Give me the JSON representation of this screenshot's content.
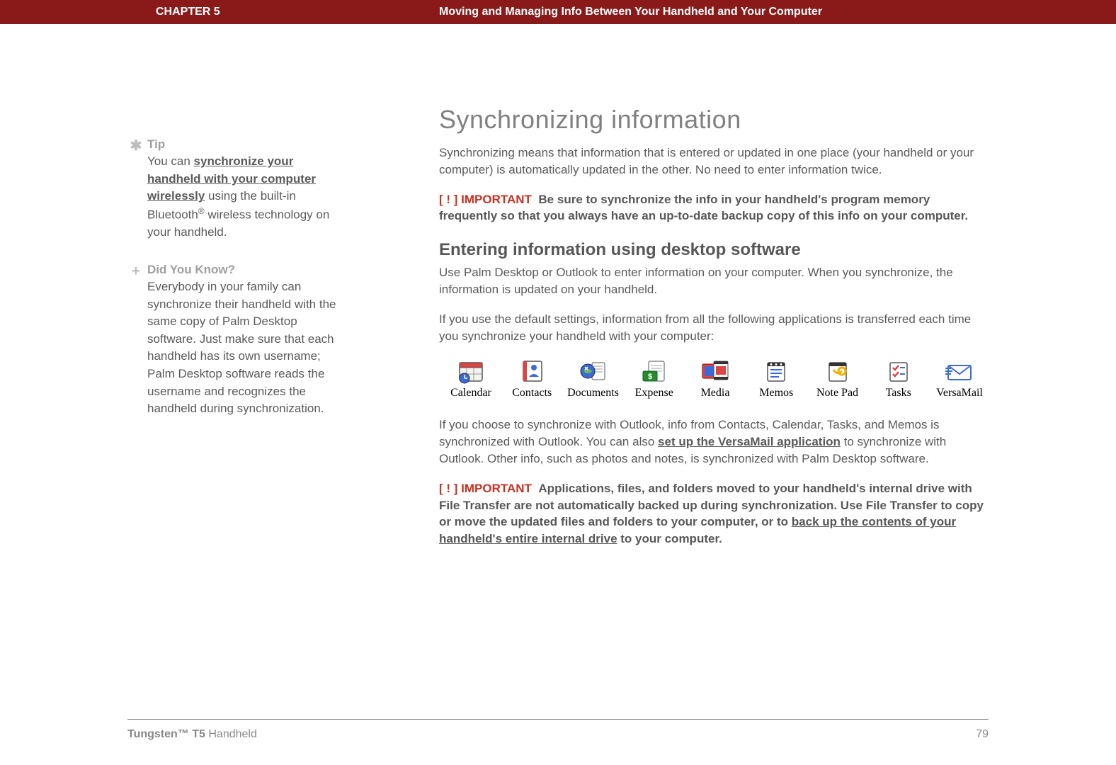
{
  "header": {
    "chapter": "CHAPTER 5",
    "title": "Moving and Managing Info Between Your Handheld and Your Computer"
  },
  "sidebar": {
    "tip": {
      "heading": "Tip",
      "linkText": "synchronize your handheld with your computer wirelessly",
      "afterText": " using the built-in Bluetooth",
      "reg": "®",
      "afterReg": " wireless technology on your handheld."
    },
    "dyk": {
      "heading": "Did You Know?",
      "text": "Everybody in your family can synchronize their handheld with the same copy of Palm Desktop software. Just make sure that each handheld has its own username; Palm Desktop software reads the username and recognizes the handheld during synchronization."
    }
  },
  "main": {
    "h1": "Synchronizing information",
    "intro": "Synchronizing means that information that is entered or updated in one place (your handheld or your computer) is automatically updated in the other. No need to enter information twice.",
    "important1": {
      "label": "IMPORTANT",
      "text": "Be sure to synchronize the info in your handheld's program memory frequently so that you always have an up-to-date backup copy of this info on your computer."
    },
    "h2": "Entering information using desktop software",
    "p2": "Use Palm Desktop or Outlook to enter information on your computer. When you synchronize, the information is updated on your handheld.",
    "p3": "If you use the default settings, information from all the following applications is transferred each time you synchronize your handheld with your computer:",
    "apps": [
      {
        "label": "Calendar"
      },
      {
        "label": "Contacts"
      },
      {
        "label": "Documents"
      },
      {
        "label": "Expense"
      },
      {
        "label": "Media"
      },
      {
        "label": "Memos"
      },
      {
        "label": "Note Pad"
      },
      {
        "label": "Tasks"
      },
      {
        "label": "VersaMail"
      }
    ],
    "p4_before": "If you choose to synchronize with Outlook, info from Contacts, Calendar, Tasks, and Memos is synchronized with Outlook. You can also ",
    "p4_link": "set up the VersaMail application",
    "p4_after": " to synchronize with Outlook. Other info, such as photos and notes, is synchronized with Palm Desktop software.",
    "important2": {
      "label": "IMPORTANT",
      "before": "Applications, files, and folders moved to your handheld's internal drive with File Transfer are not automatically backed up during synchronization. Use File Transfer to copy or move the updated files and folders to your computer, or to ",
      "link": "back up the contents of your handheld's entire internal drive",
      "after": " to your computer."
    }
  },
  "footer": {
    "bold": "Tungsten™ T5",
    "rest": " Handheld",
    "page": "79"
  }
}
